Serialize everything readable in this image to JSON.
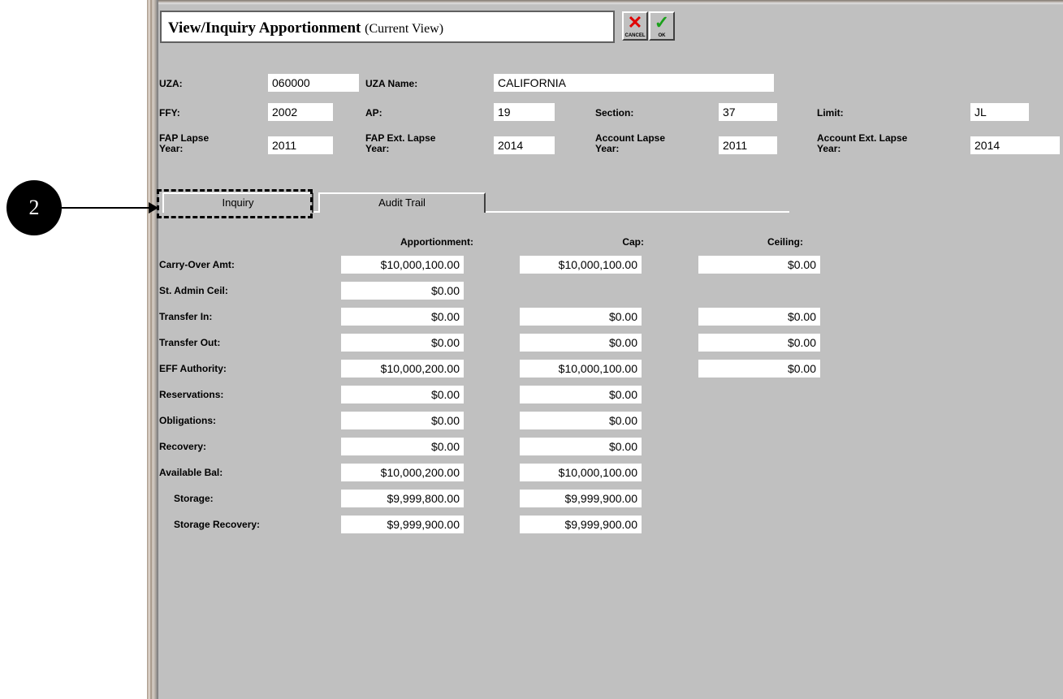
{
  "header": {
    "title": "View/Inquiry Apportionment",
    "subtitle": "(Current View)",
    "cancel_label": "CANCEL",
    "ok_label": "OK",
    "cancel_icon": "red-x-icon",
    "ok_icon": "green-check-icon"
  },
  "fields": {
    "uza_label": "UZA:",
    "uza_value": "060000",
    "uza_name_label": "UZA Name:",
    "uza_name_value": "CALIFORNIA",
    "ffy_label": "FFY:",
    "ffy_value": "2002",
    "ap_label": "AP:",
    "ap_value": "19",
    "section_label": "Section:",
    "section_value": "37",
    "limit_label": "Limit:",
    "limit_value": "JL",
    "fap_lapse_label_1": "FAP Lapse",
    "fap_lapse_label_2": "Year:",
    "fap_lapse_value": "2011",
    "fap_ext_label_1": "FAP Ext. Lapse",
    "fap_ext_label_2": "Year:",
    "fap_ext_value": "2014",
    "acct_lapse_label_1": "Account Lapse",
    "acct_lapse_label_2": "Year:",
    "acct_lapse_value": "2011",
    "acct_ext_label_1": "Account  Ext. Lapse",
    "acct_ext_label_2": "Year:",
    "acct_ext_value": "2014"
  },
  "tabs": [
    {
      "label": "Inquiry",
      "active": true
    },
    {
      "label": "Audit Trail",
      "active": false
    }
  ],
  "callout": {
    "number": "2"
  },
  "grid": {
    "col_apportionment": "Apportionment:",
    "col_cap": "Cap:",
    "col_ceiling": "Ceiling:",
    "rows": [
      {
        "label": "Carry-Over Amt:",
        "apportionment": "$10,000,100.00",
        "cap": "$10,000,100.00",
        "ceiling": "$0.00"
      },
      {
        "label": "St. Admin Ceil:",
        "apportionment": "$0.00",
        "cap": null,
        "ceiling": null
      },
      {
        "label": "Transfer In:",
        "apportionment": "$0.00",
        "cap": "$0.00",
        "ceiling": "$0.00"
      },
      {
        "label": "Transfer Out:",
        "apportionment": "$0.00",
        "cap": "$0.00",
        "ceiling": "$0.00"
      },
      {
        "label": "EFF Authority:",
        "apportionment": "$10,000,200.00",
        "cap": "$10,000,100.00",
        "ceiling": "$0.00"
      },
      {
        "label": "Reservations:",
        "apportionment": "$0.00",
        "cap": "$0.00",
        "ceiling": null
      },
      {
        "label": "Obligations:",
        "apportionment": "$0.00",
        "cap": "$0.00",
        "ceiling": null
      },
      {
        "label": "Recovery:",
        "apportionment": "$0.00",
        "cap": "$0.00",
        "ceiling": null
      },
      {
        "label": "Available Bal:",
        "apportionment": "$10,000,200.00",
        "cap": "$10,000,100.00",
        "ceiling": null
      },
      {
        "label": "Storage:",
        "apportionment": "$9,999,800.00",
        "cap": "$9,999,900.00",
        "ceiling": null
      },
      {
        "label": "Storage Recovery:",
        "apportionment": "$9,999,900.00",
        "cap": "$9,999,900.00",
        "ceiling": null
      }
    ]
  }
}
